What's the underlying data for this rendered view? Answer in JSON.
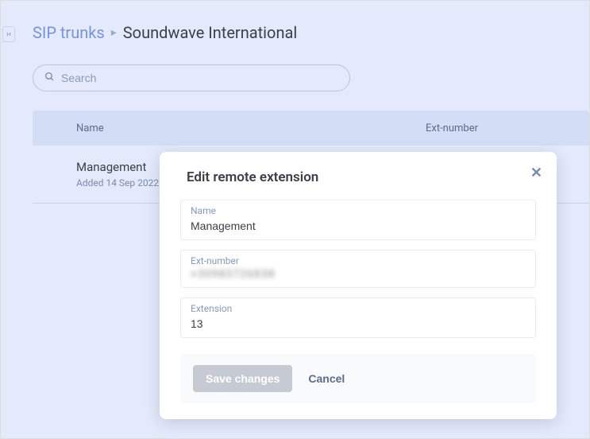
{
  "breadcrumb": {
    "parent": "SIP trunks",
    "current": "Soundwave International"
  },
  "search": {
    "placeholder": "Search"
  },
  "table": {
    "headers": {
      "name": "Name",
      "ext": "Ext-number"
    },
    "rows": [
      {
        "title": "Management",
        "sub": "Added 14 Sep 2022"
      }
    ]
  },
  "modal": {
    "title": "Edit remote extension",
    "fields": {
      "name": {
        "label": "Name",
        "value": "Management"
      },
      "extnumber": {
        "label": "Ext-number",
        "value": "+30983726838"
      },
      "extension": {
        "label": "Extension",
        "value": "13"
      }
    },
    "buttons": {
      "save": "Save changes",
      "cancel": "Cancel"
    }
  }
}
